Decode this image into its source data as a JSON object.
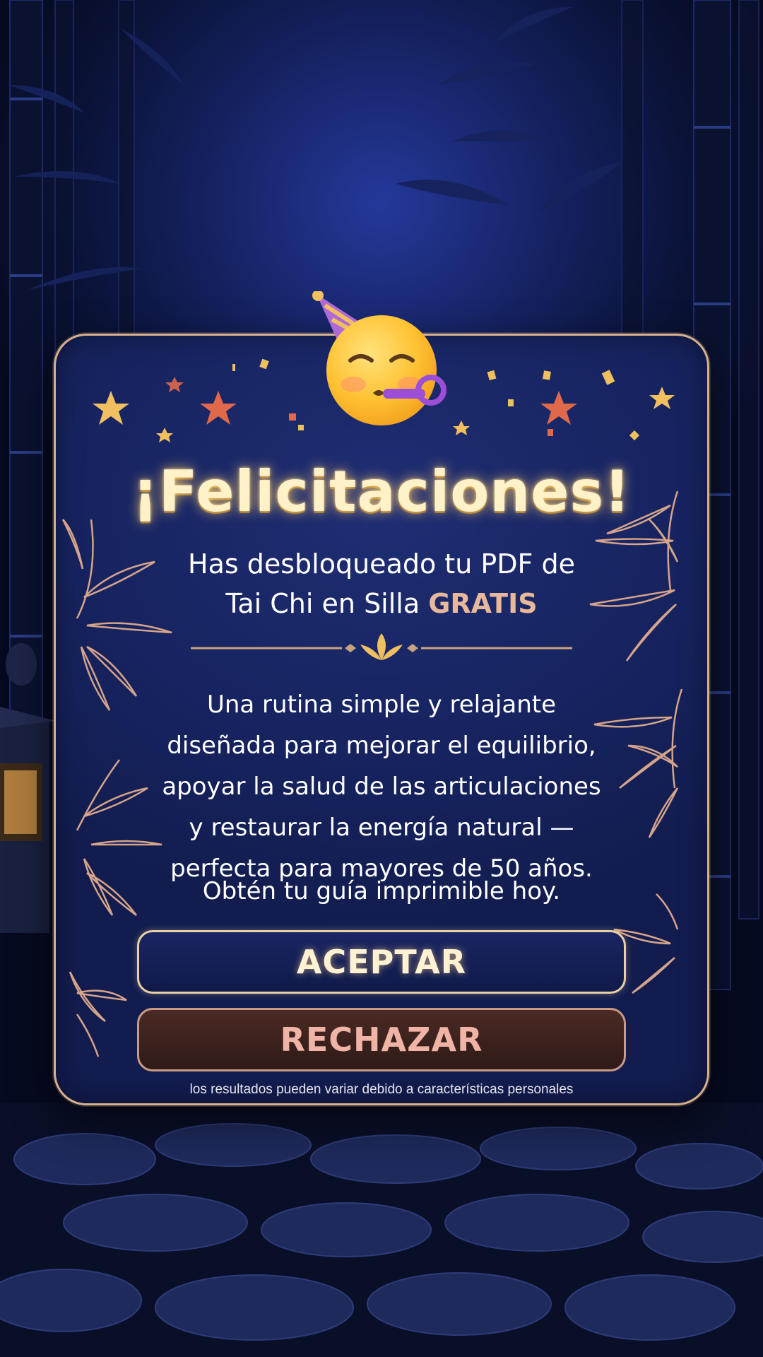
{
  "popup": {
    "title": "¡Felicitaciones!",
    "subtitle_line1": "Has desbloqueado tu PDF de",
    "subtitle_line2_prefix": "Tai Chi en Silla ",
    "subtitle_highlight": "GRATIS",
    "body_lines": [
      "Una rutina simple y relajante",
      "diseñada para mejorar el equilibrio,",
      "apoyar la salud de las articulaciones",
      "y restaurar la energía natural —",
      "perfecta para mayores de 50 años."
    ],
    "cta": "Obtén tu guía imprimible hoy.",
    "accept_label": "ACEPTAR",
    "reject_label": "RECHAZAR",
    "disclaimer": "los resultados pueden variar debido a características personales",
    "icons": [
      "partying-face-icon",
      "star-icon",
      "confetti-icon",
      "lotus-divider-icon",
      "bamboo-leaves-icon"
    ]
  },
  "background": {
    "scene": [
      "bamboo-forest-icon",
      "stone-lantern-icon",
      "stone-path-icon"
    ]
  },
  "colors": {
    "card_bg": "#172461",
    "card_border": "#d9b08c",
    "title": "#fff2c9",
    "highlight": "#e8b89a",
    "accept_bg": "#101a4a",
    "reject_bg": "#3a211c",
    "reject_text": "#f0b4a6"
  }
}
